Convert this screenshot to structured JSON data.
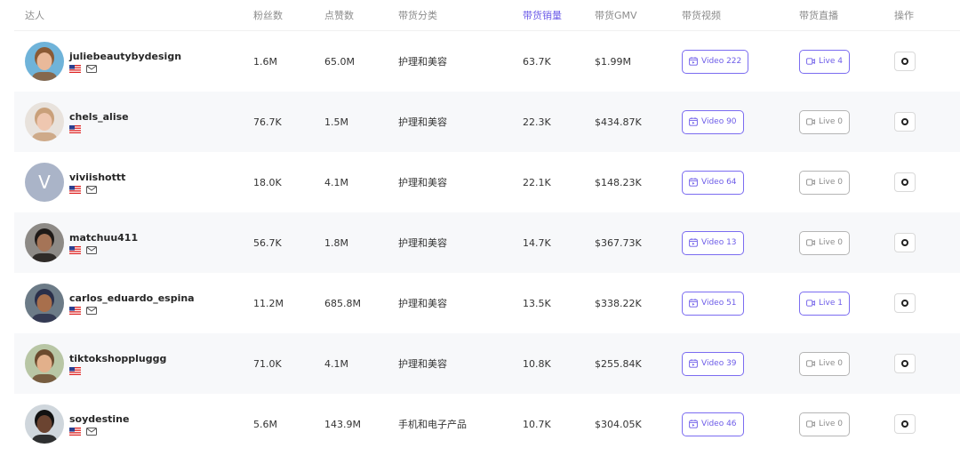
{
  "columns": {
    "creator": "达人",
    "followers": "粉丝数",
    "likes": "点赞数",
    "category": "带货分类",
    "sales": "带货销量",
    "gmv": "带货GMV",
    "video": "带货视频",
    "live": "带货直播",
    "action": "操作"
  },
  "colors": {
    "accent": "#6d5ce8",
    "muted": "#8c8c8c",
    "stripe": "#f7f8fa"
  },
  "rows": [
    {
      "name": "juliebeautybydesign",
      "followers": "1.6M",
      "likes": "65.0M",
      "category": "护理和美容",
      "sales": "63.7K",
      "gmv": "$1.99M",
      "video": "Video 222",
      "live": "Live 4",
      "live_active": true,
      "mail": true,
      "avatar_letter": ""
    },
    {
      "name": "chels_alise",
      "followers": "76.7K",
      "likes": "1.5M",
      "category": "护理和美容",
      "sales": "22.3K",
      "gmv": "$434.87K",
      "video": "Video 90",
      "live": "Live 0",
      "live_active": false,
      "mail": false,
      "avatar_letter": ""
    },
    {
      "name": "viviishottt",
      "followers": "18.0K",
      "likes": "4.1M",
      "category": "护理和美容",
      "sales": "22.1K",
      "gmv": "$148.23K",
      "video": "Video 64",
      "live": "Live 0",
      "live_active": false,
      "mail": true,
      "avatar_letter": "V"
    },
    {
      "name": "matchuu411",
      "followers": "56.7K",
      "likes": "1.8M",
      "category": "护理和美容",
      "sales": "14.7K",
      "gmv": "$367.73K",
      "video": "Video 13",
      "live": "Live 0",
      "live_active": false,
      "mail": true,
      "avatar_letter": ""
    },
    {
      "name": "carlos_eduardo_espina",
      "followers": "11.2M",
      "likes": "685.8M",
      "category": "护理和美容",
      "sales": "13.5K",
      "gmv": "$338.22K",
      "video": "Video 51",
      "live": "Live 1",
      "live_active": true,
      "mail": true,
      "avatar_letter": ""
    },
    {
      "name": "tiktokshoppluggg",
      "followers": "71.0K",
      "likes": "4.1M",
      "category": "护理和美容",
      "sales": "10.8K",
      "gmv": "$255.84K",
      "video": "Video 39",
      "live": "Live 0",
      "live_active": false,
      "mail": false,
      "avatar_letter": ""
    },
    {
      "name": "soydestine",
      "followers": "5.6M",
      "likes": "143.9M",
      "category": "手机和电子产品",
      "sales": "10.7K",
      "gmv": "$304.05K",
      "video": "Video 46",
      "live": "Live 0",
      "live_active": false,
      "mail": true,
      "avatar_letter": ""
    }
  ]
}
